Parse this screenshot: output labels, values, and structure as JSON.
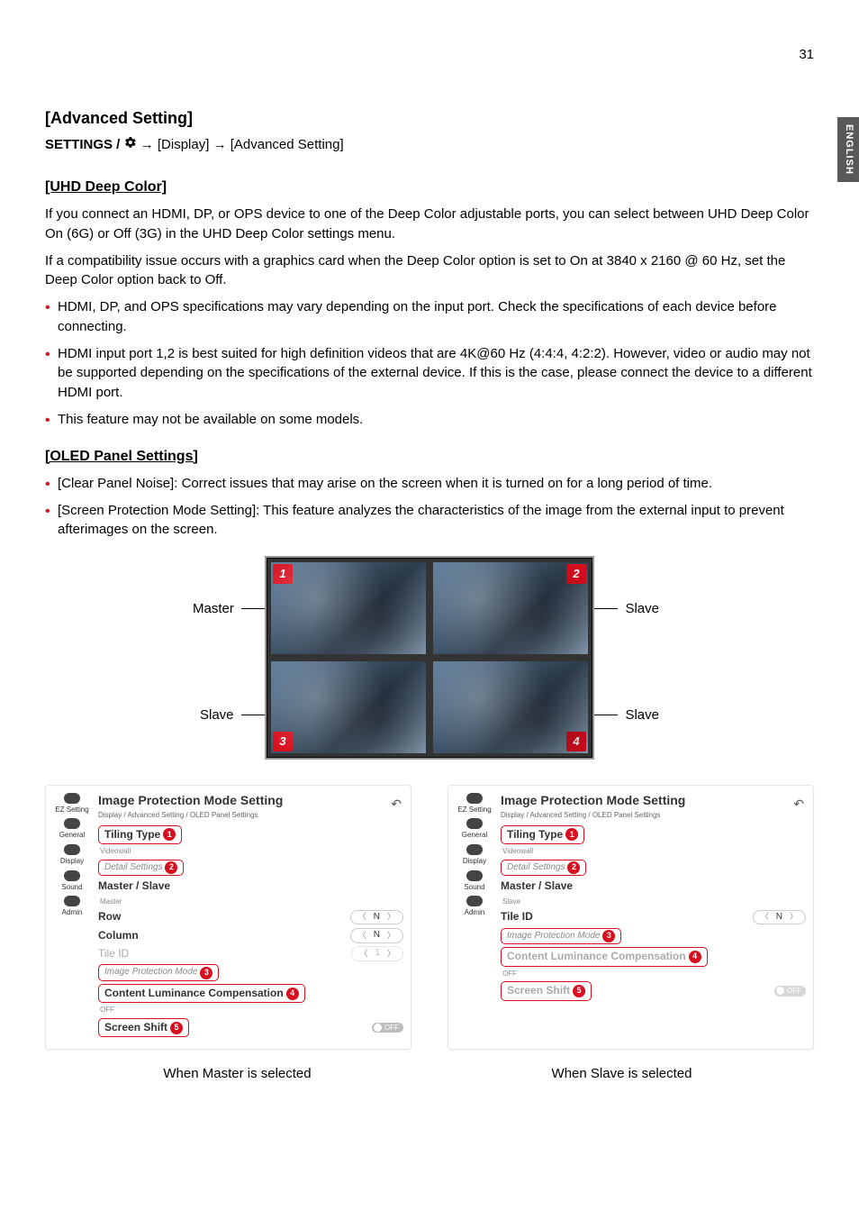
{
  "page_number": "31",
  "language_tab": "ENGLISH",
  "section_title": "[Advanced Setting]",
  "settings_path": {
    "prefix": "SETTINGS / ",
    "seg1": "[Display]",
    "seg2": "[Advanced Setting]"
  },
  "uhd": {
    "title": "[UHD Deep Color]",
    "para1": "If you connect an HDMI, DP, or OPS device to one of the Deep Color adjustable ports, you can select between UHD Deep Color On (6G) or Off (3G) in the UHD Deep Color settings menu.",
    "para2": "If a compatibility issue occurs with a graphics card when the Deep Color option is set to On at 3840 x 2160 @ 60 Hz, set the Deep Color option back to Off.",
    "bullets": [
      "HDMI, DP, and OPS specifications may vary depending on the input port. Check the specifications of each device before connecting.",
      "HDMI input port 1,2 is best suited for high definition videos that are 4K@60 Hz (4:4:4, 4:2:2). However, video or audio may not be supported depending on the specifications of the external device. If this is the case, please connect the device to a different HDMI port.",
      "This feature may not be available on some models."
    ]
  },
  "oled": {
    "title": "[OLED Panel Settings]",
    "bullets": [
      "[Clear Panel Noise]: Correct issues that may arise on the screen when it is turned on for a long period of time.",
      "[Screen Protection Mode Setting]: This feature analyzes the characteristics of the image from the external input to prevent afterimages on the screen."
    ]
  },
  "diagram": {
    "labels": {
      "master": "Master",
      "slave": "Slave"
    },
    "corner_nums": [
      "1",
      "2",
      "3",
      "4"
    ]
  },
  "ui_common": {
    "panel_title": "Image Protection Mode Setting",
    "crumb": "Display / Advanced Setting / OLED Panel Settings",
    "nav": [
      "EZ Setting",
      "General",
      "Display",
      "Sound",
      "Admin"
    ],
    "row_tiling_type": "Tiling Type",
    "row_detail_settings": "Detail Settings",
    "row_master_slave": "Master / Slave",
    "row_row": "Row",
    "row_column": "Column",
    "row_tile_id": "Tile ID",
    "row_image_protection_mode": "Image Protection Mode",
    "row_content_luminance": "Content Luminance Compensation",
    "row_screen_shift": "Screen Shift",
    "val_videowall": "Videowall",
    "val_master": "Master",
    "val_slave": "Slave",
    "val_off_small": "OFF",
    "val_n": "N",
    "val_1": "1",
    "toggle_off": "OFF",
    "badges": {
      "n1": "1",
      "n2": "2",
      "n3": "3",
      "n4": "4",
      "n5": "5"
    }
  },
  "captions": {
    "left": "When Master is selected",
    "right": "When Slave is selected"
  }
}
